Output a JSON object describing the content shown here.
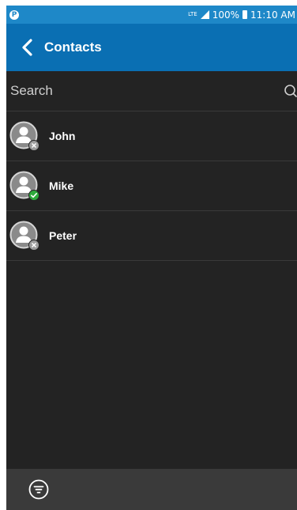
{
  "status_bar": {
    "app_icon_letter": "P",
    "network": "LTE",
    "battery": "100%",
    "time": "11:10 AM"
  },
  "app_bar": {
    "title": "Contacts",
    "back_icon": "chevron-left-icon"
  },
  "search": {
    "placeholder": "Search",
    "value": "",
    "icon": "search-icon"
  },
  "contacts": [
    {
      "name": "John",
      "status": "offline"
    },
    {
      "name": "Mike",
      "status": "online"
    },
    {
      "name": "Peter",
      "status": "offline"
    }
  ],
  "bottom_bar": {
    "filter_icon": "filter-icon"
  },
  "colors": {
    "status_bar": "#1e88c8",
    "app_bar": "#0a6fb3",
    "background": "#232323",
    "bottom_bar": "#3a3a3a",
    "online": "#2eaa3c",
    "offline": "#9e9e9e"
  }
}
